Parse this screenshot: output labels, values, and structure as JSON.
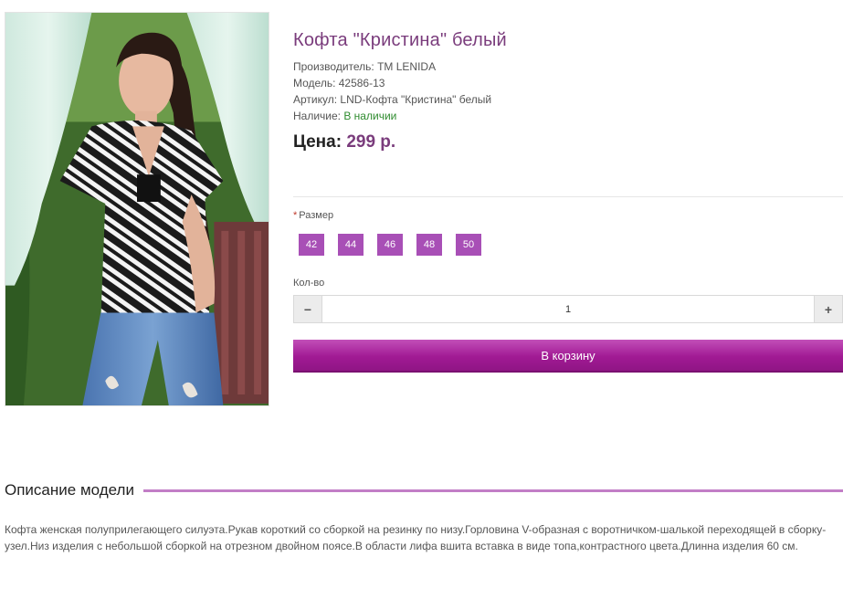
{
  "product": {
    "title": "Кофта \"Кристина\" белый",
    "manufacturer": "Производитель: TM LENIDA",
    "model": "Модель: 42586-13",
    "article": "Артикул: LND-Кофта \"Кристина\" белый",
    "availability_label": "Наличие: ",
    "availability_value": "В наличии",
    "price_label": "Цена: ",
    "price_value": "299 р."
  },
  "options": {
    "size_required_mark": "*",
    "size_label": "Размер",
    "sizes": [
      "42",
      "44",
      "46",
      "48",
      "50"
    ],
    "qty_label": "Кол-во",
    "qty_value": "1",
    "minus": "−",
    "plus": "+"
  },
  "cart": {
    "button_label": "В корзину"
  },
  "description": {
    "heading": "Описание модели",
    "text": "Кофта женская полуприлегающего силуэта.Рукав короткий со сборкой на резинку по низу.Горловина V-образная с воротничком-шалькой переходящей в сборку-узел.Низ изделия с небольшой сборкой на отрезном двойном поясе.В области лифа вшита вставка в виде топа,контрастного цвета.Длинна изделия 60 см."
  },
  "colors": {
    "accent": "#7a3c7c",
    "size_button": "#a84fb6",
    "cart_button": "#a11a94",
    "in_stock": "#2e8b2e",
    "description_rule": "#c27ec6"
  }
}
